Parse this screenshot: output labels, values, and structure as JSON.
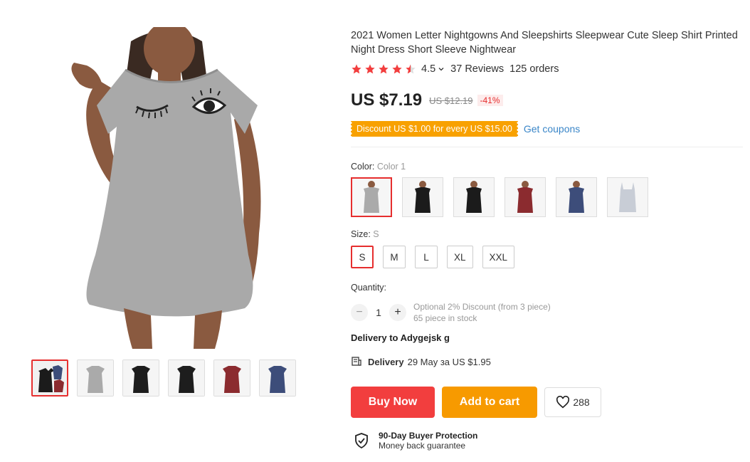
{
  "product": {
    "title": "2021 Women Letter Nightgowns And Sleepshirts Sleepwear Cute Sleep Shirt Printed Night Dress Short Sleeve Nightwear",
    "rating": "4.5",
    "reviews": "37 Reviews",
    "orders": "125 orders",
    "price": "US $7.19",
    "old_price": "US $12.19",
    "discount": "-41%",
    "coupon": "Discount US $1.00 for every US $15.00",
    "get_coupons": "Get coupons"
  },
  "color": {
    "label": "Color:",
    "selected": "Color 1",
    "options": [
      "gray",
      "black-print",
      "black-eyes",
      "wine-red",
      "navy",
      "silver-satin"
    ]
  },
  "size": {
    "label": "Size:",
    "selected": "S",
    "options": [
      "S",
      "M",
      "L",
      "XL",
      "XXL"
    ]
  },
  "quantity": {
    "label": "Quantity:",
    "value": "1",
    "minus": "−",
    "plus": "+",
    "discount_note": "Optional 2% Discount (from 3 piece)",
    "stock": "65 piece in stock"
  },
  "delivery": {
    "to": "Delivery to Adygejsk g",
    "label": "Delivery",
    "details": "29 May за US $1.95"
  },
  "actions": {
    "buy_now": "Buy Now",
    "add_to_cart": "Add to cart",
    "wishlist_count": "288"
  },
  "protection": {
    "title": "90-Day Buyer Protection",
    "subtitle": "Money back guarantee"
  },
  "colors": {
    "accent_red": "#e62e2e",
    "buy_now": "#f23e3e",
    "add_cart": "#f79a00",
    "coupon": "#f8a100",
    "link": "#3a86c8"
  },
  "icons": [
    "star-icon",
    "chevron-down-icon",
    "delivery-icon",
    "heart-icon",
    "shield-check-icon"
  ]
}
